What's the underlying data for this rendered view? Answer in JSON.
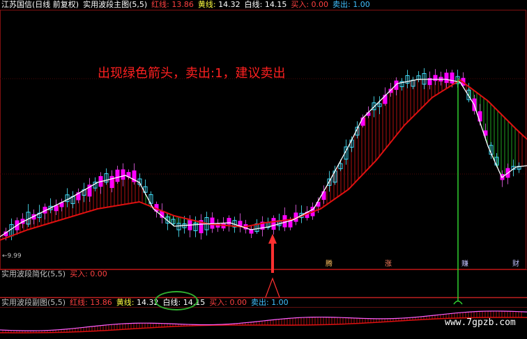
{
  "main_panel": {
    "stock": "江苏国信(日线 前复权)",
    "indicator": "实用波段主图(5,5)",
    "red_label": "红线:",
    "red_value": "13.86",
    "yellow_label": "黄线:",
    "yellow_value": "14.32",
    "white_label": "白线:",
    "white_value": "14.15",
    "buy_label": "买入:",
    "buy_value": "0.00",
    "sell_label": "卖出:",
    "sell_value": "1.00",
    "annotation": "出现绿色箭头，卖出:1，建议卖出",
    "low_price": "←9.99"
  },
  "simplified_panel": {
    "indicator": "实用波段简化(5,5)",
    "buy_label": "买入:",
    "buy_value": "0.00"
  },
  "sub_panel": {
    "indicator": "实用波段副图(5,5)",
    "red_label": "红线:",
    "red_value": "13.86",
    "yellow_label": "黄线:",
    "yellow_value": "14.32",
    "white_label": "白线:",
    "white_value": "14.15",
    "buy_label": "买入:",
    "buy_value": "0.00",
    "sell_label": "卖出:",
    "sell_value": "1.00"
  },
  "event_tags": [
    {
      "label": "腾",
      "color": "#ffc060"
    },
    {
      "label": "涨",
      "color": "#ff8060"
    },
    {
      "label": "赚",
      "color": "#c0c0ff"
    },
    {
      "label": "财",
      "color": "#c0c0ff"
    }
  ],
  "watermark": "www.7gpzb.com",
  "colors": {
    "up_candle": "#ff00ff",
    "down_candle": "#40e0ff",
    "red_line": "#e01010",
    "white_line": "#ffffff",
    "sell_arrow": "#30d030",
    "buy_arrow": "#ff3030"
  }
}
